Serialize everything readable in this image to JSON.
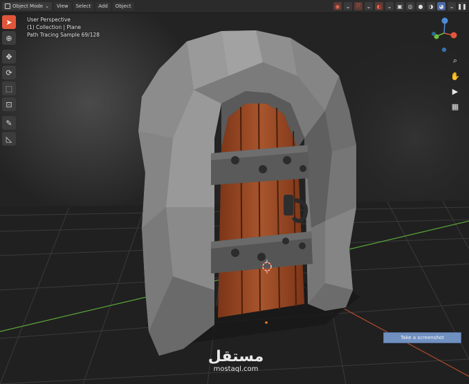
{
  "header": {
    "mode_label": "Object Mode",
    "menus": [
      "View",
      "Select",
      "Add",
      "Object"
    ],
    "right_icons": [
      "view-object-types-icon",
      "gizmo-icon",
      "overlay-icon",
      "xray-icon",
      "wireframe-shading-icon",
      "solid-shading-icon",
      "material-shading-icon",
      "rendered-shading-icon",
      "pause-icon"
    ]
  },
  "toolbar": {
    "tools": [
      "select-cursor-icon",
      "cursor-icon",
      "move-icon",
      "rotate-icon",
      "scale-icon",
      "transform-icon",
      "annotate-icon",
      "measure-icon"
    ]
  },
  "overlay": {
    "view_name": "User Perspective",
    "collection": "(1) Collection | Plane",
    "render_status": "Path Tracing Sample 69/128"
  },
  "navigation": {
    "gizmo_axes": [
      "x-axis",
      "y-axis",
      "z-axis"
    ],
    "tools": [
      "zoom-icon",
      "hand-pan-icon",
      "camera-icon",
      "grid-view-icon"
    ]
  },
  "tooltip": {
    "text": "Take a screenshot"
  },
  "watermark": {
    "arabic": "مستقل",
    "latin": "mostaql.com"
  },
  "colors": {
    "accent_active_tool": "#e0563a",
    "stone": "#7a7a7a",
    "wood": "#9a4a2a",
    "metal": "#555555",
    "x_axis": "#e0563a",
    "y_axis": "#6fbf3a",
    "z_axis": "#4e8bd6",
    "tooltip_bg": "#7090c0"
  }
}
